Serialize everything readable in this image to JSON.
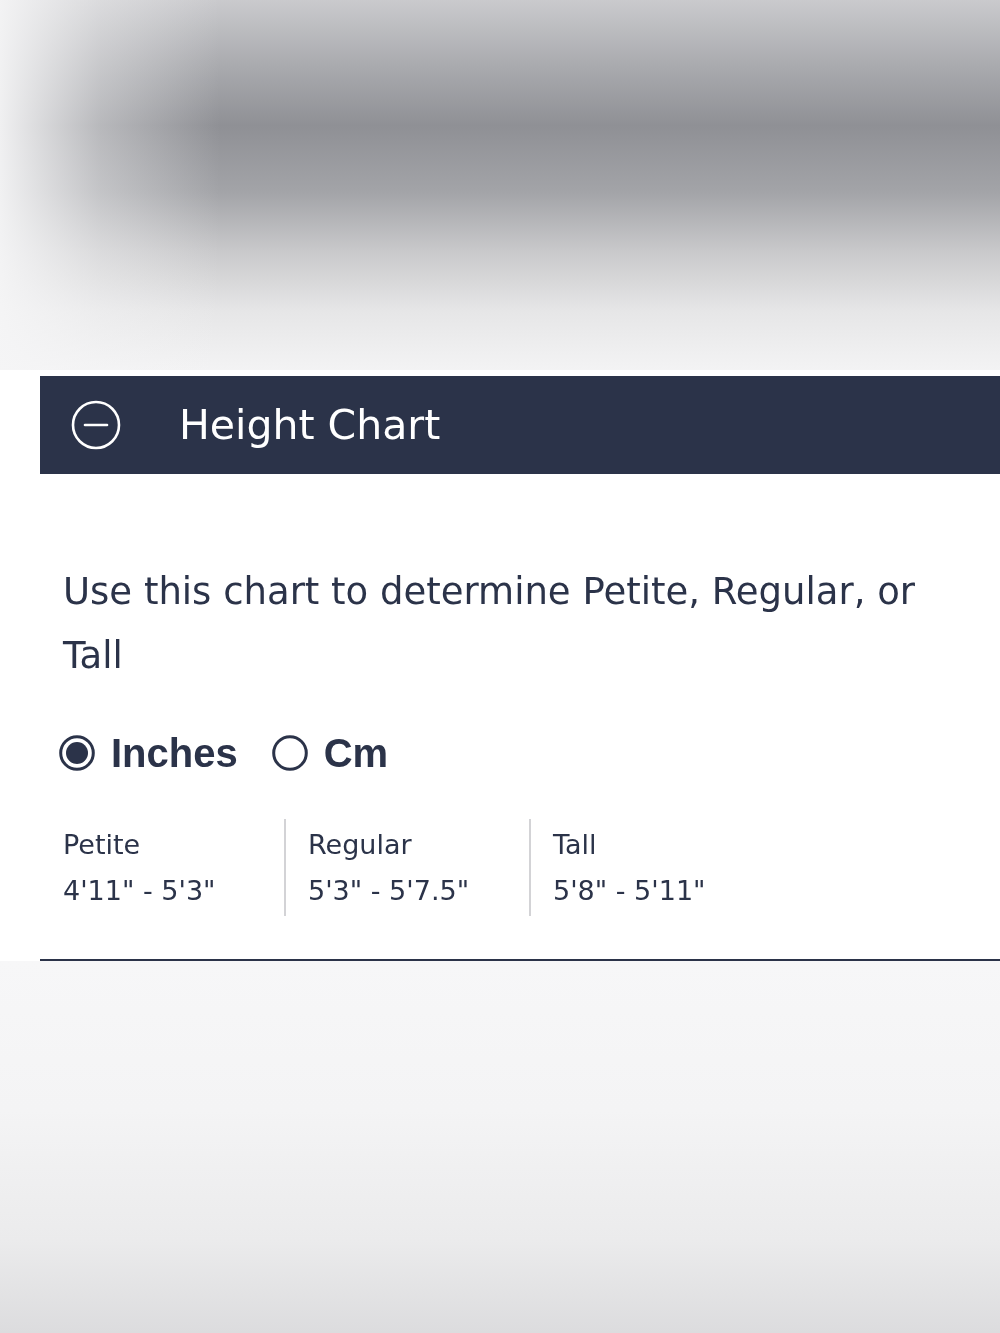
{
  "header": {
    "title": "Height Chart",
    "expanded": true
  },
  "description": "Use this chart to determine Petite, Regular, or Tall",
  "units": [
    {
      "label": "Inches",
      "selected": true
    },
    {
      "label": "Cm",
      "selected": false
    }
  ],
  "sizes": [
    {
      "name": "Petite",
      "range": "4'11\" - 5'3\""
    },
    {
      "name": "Regular",
      "range": "5'3\" - 5'7.5\""
    },
    {
      "name": "Tall",
      "range": "5'8\" - 5'11\""
    }
  ]
}
